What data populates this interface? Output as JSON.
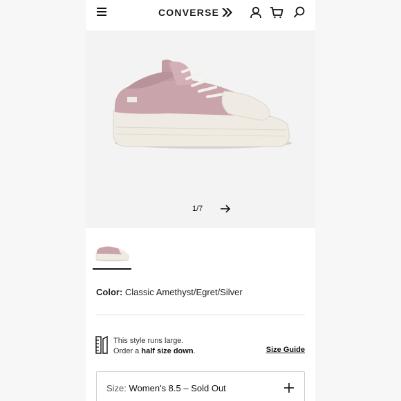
{
  "header": {
    "brand": "CONVERSE",
    "icons": [
      "menu-icon",
      "account-icon",
      "cart-icon",
      "search-icon"
    ]
  },
  "gallery": {
    "counter": "1/7"
  },
  "product": {
    "color_label": "Color:",
    "color_value": "Classic Amethyst/Egret/Silver"
  },
  "fit": {
    "line1": "This style runs large.",
    "line2_prefix": "Order a ",
    "line2_bold": "half size down",
    "line2_suffix": ".",
    "size_guide": "Size Guide"
  },
  "size": {
    "label": "Size:",
    "value": "Women's 8.5 – Sold Out"
  },
  "colors": {
    "shoe_upper": "#c9a4aa",
    "shoe_sole": "#efeae2",
    "background": "#f3f3f3"
  }
}
